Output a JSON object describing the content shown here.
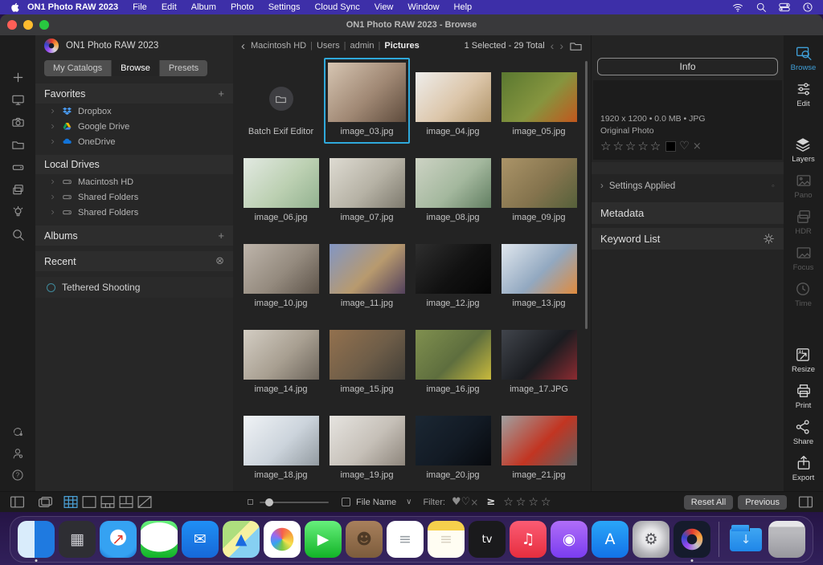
{
  "menu_bar": {
    "app_name": "ON1 Photo RAW 2023",
    "items": [
      "File",
      "Edit",
      "Album",
      "Photo",
      "Settings",
      "Cloud Sync",
      "View",
      "Window",
      "Help"
    ],
    "right_icons": [
      "wifi-icon",
      "search-icon",
      "control-center-icon",
      "clock-icon"
    ]
  },
  "window": {
    "title": "ON1 Photo RAW 2023 - Browse"
  },
  "left_rail": {
    "top": [
      "plus-icon",
      "monitor-icon",
      "camera-icon",
      "folder-icon",
      "drive-icon",
      "copies-icon",
      "bulb-icon",
      "search-icon"
    ],
    "bottom": [
      "sync-icon",
      "user-icon",
      "help-icon"
    ]
  },
  "sidebar": {
    "app_title": "ON1 Photo RAW 2023",
    "tabs": [
      {
        "label": "My Catalogs",
        "active": false
      },
      {
        "label": "Browse",
        "active": true
      },
      {
        "label": "Presets",
        "active": false
      }
    ],
    "sections": {
      "favorites": {
        "label": "Favorites",
        "action_icon": "plus-icon",
        "items": [
          {
            "label": "Dropbox",
            "icon": "dropbox-icon"
          },
          {
            "label": "Google Drive",
            "icon": "gdrive-icon"
          },
          {
            "label": "OneDrive",
            "icon": "onedrive-icon"
          }
        ]
      },
      "local_drives": {
        "label": "Local Drives",
        "items": [
          {
            "label": "Macintosh HD",
            "icon": "drive-icon"
          },
          {
            "label": "Shared Folders",
            "icon": "drive-icon"
          },
          {
            "label": "Shared Folders",
            "icon": "drive-icon"
          }
        ]
      },
      "albums": {
        "label": "Albums",
        "action_icon": "plus-icon"
      },
      "recent": {
        "label": "Recent",
        "action_icon": "clear-icon"
      },
      "tethered": {
        "label": "Tethered Shooting"
      }
    }
  },
  "browser_header": {
    "path": [
      "Macintosh HD",
      "Users",
      "admin",
      "Pictures"
    ],
    "status": "1 Selected - 29 Total"
  },
  "grid": {
    "selection_color": "#2fa9db",
    "items": [
      {
        "kind": "folder",
        "label": "Batch Exif Editor"
      },
      {
        "kind": "image",
        "label": "image_03.jpg",
        "selected": true,
        "colors": [
          "#d6c5b2",
          "#a08874",
          "#5f4c3d"
        ]
      },
      {
        "kind": "image",
        "label": "image_04.jpg",
        "colors": [
          "#eeedeb",
          "#dcc6aa",
          "#b09468"
        ]
      },
      {
        "kind": "image",
        "label": "image_05.jpg",
        "colors": [
          "#5a7830",
          "#86953f",
          "#c2571d"
        ]
      },
      {
        "kind": "image",
        "label": "image_06.jpg",
        "colors": [
          "#e2e9e2",
          "#bcd0b2",
          "#93b290"
        ]
      },
      {
        "kind": "image",
        "label": "image_07.jpg",
        "colors": [
          "#dedbd2",
          "#b6b2a5",
          "#7e7a6e"
        ]
      },
      {
        "kind": "image",
        "label": "image_08.jpg",
        "colors": [
          "#cdd3c4",
          "#a4b89e",
          "#627f62"
        ]
      },
      {
        "kind": "image",
        "label": "image_09.jpg",
        "colors": [
          "#ab9468",
          "#85744e",
          "#55603a"
        ]
      },
      {
        "kind": "image",
        "label": "image_10.jpg",
        "colors": [
          "#beb5ab",
          "#948a7e",
          "#5e544a"
        ]
      },
      {
        "kind": "image",
        "label": "image_11.jpg",
        "colors": [
          "#8296c4",
          "#b89a6e",
          "#52405c"
        ]
      },
      {
        "kind": "image",
        "label": "image_12.jpg",
        "colors": [
          "#2e2e2e",
          "#111111",
          "#050505"
        ]
      },
      {
        "kind": "image",
        "label": "image_13.jpg",
        "colors": [
          "#e0e7ee",
          "#92a8c0",
          "#e08b3e"
        ]
      },
      {
        "kind": "image",
        "label": "image_14.jpg",
        "colors": [
          "#d3cdc3",
          "#a89f91",
          "#6e665c"
        ]
      },
      {
        "kind": "image",
        "label": "image_15.jpg",
        "colors": [
          "#93714e",
          "#6e5d48",
          "#423e37"
        ]
      },
      {
        "kind": "image",
        "label": "image_16.jpg",
        "colors": [
          "#80904f",
          "#5e6e3e",
          "#c9ba3d"
        ]
      },
      {
        "kind": "image",
        "label": "image_17.JPG",
        "colors": [
          "#41454c",
          "#1a1c20",
          "#8c2b31"
        ]
      },
      {
        "kind": "image",
        "label": "image_18.jpg",
        "colors": [
          "#f0f3f6",
          "#ccd4dc",
          "#939ba1"
        ]
      },
      {
        "kind": "image",
        "label": "image_19.jpg",
        "colors": [
          "#e6e4e0",
          "#c6c0b8",
          "#8e867c"
        ]
      },
      {
        "kind": "image",
        "label": "image_20.jpg",
        "colors": [
          "#1b2733",
          "#121a24",
          "#07090d"
        ]
      },
      {
        "kind": "image",
        "label": "image_21.jpg",
        "colors": [
          "#a0a0a0",
          "#c23522",
          "#606060"
        ]
      }
    ]
  },
  "info_panel": {
    "button_label": "Info",
    "details": "1920 x 1200  •  0.0 MB  •  JPG",
    "type_label": "Original Photo",
    "rating_stars": 5,
    "swatch_color": "#000000",
    "settings_applied_label": "Settings Applied",
    "metadata_label": "Metadata",
    "keyword_list_label": "Keyword List"
  },
  "right_rail": {
    "accent": "#3f9fd8",
    "top": [
      {
        "label": "Browse",
        "icon": "browse-icon",
        "state": "active"
      },
      {
        "label": "Edit",
        "icon": "edit-icon",
        "state": "normal"
      }
    ],
    "middle": [
      {
        "label": "Layers",
        "icon": "layers-icon",
        "state": "normal"
      },
      {
        "label": "Pano",
        "icon": "pano-icon",
        "state": "disabled"
      },
      {
        "label": "HDR",
        "icon": "hdr-icon",
        "state": "disabled"
      },
      {
        "label": "Focus",
        "icon": "focus-icon",
        "state": "disabled"
      },
      {
        "label": "Time",
        "icon": "time-icon",
        "state": "disabled"
      }
    ],
    "bottom": [
      {
        "label": "Resize",
        "icon": "resize-icon",
        "state": "normal"
      },
      {
        "label": "Print",
        "icon": "print-icon",
        "state": "normal"
      },
      {
        "label": "Share",
        "icon": "share-icon",
        "state": "normal"
      },
      {
        "label": "Export",
        "icon": "export-icon",
        "state": "normal"
      }
    ]
  },
  "bottom_bar": {
    "view_icons": [
      "grid-view-icon",
      "single-view-icon",
      "split-view-icon",
      "dual-view-icon",
      "compare-view-icon"
    ],
    "active_view": 0,
    "filename_toggle": {
      "label": "File Name",
      "checked": false
    },
    "filter": {
      "label": "Filter:",
      "ge_symbol": "≥",
      "stars": 4
    },
    "buttons": [
      {
        "label": "Reset All"
      },
      {
        "label": "Previous"
      }
    ]
  },
  "dock": {
    "items": [
      {
        "name": "finder",
        "bg": "linear-gradient(90deg,#d9ecfb 0 46%,#1f7ae0 46% 100%)",
        "glyph": "",
        "running": true
      },
      {
        "name": "launchpad",
        "bg": "#2e2e33",
        "glyph": "▦",
        "fg": "#cfcfd4"
      },
      {
        "name": "safari",
        "bg": "radial-gradient(circle at 50% 45%, #ffffff 0 28%, #35a2f2 30% 70%, #1668c8 100%)",
        "glyph": "↗",
        "fg": "#e23b2e"
      },
      {
        "name": "messages",
        "bg": "radial-gradient(ellipse 56% 40% at 50% 44%, #ffffff 98%, transparent 100%), linear-gradient(180deg,#67f07c,#12b327)",
        "glyph": ""
      },
      {
        "name": "mail",
        "bg": "linear-gradient(180deg,#1f8ff5,#1668d8)",
        "glyph": "✉",
        "fg": "#ffffff"
      },
      {
        "name": "maps",
        "bg": "linear-gradient(135deg,#aede7e 0 38%,#f6f1a0 38% 58%,#86d0f2 58% 100%)",
        "glyph": "▲",
        "fg": "#1a6ae0"
      },
      {
        "name": "photos",
        "bg": "radial-gradient(circle at 50% 50%, transparent 0 14px, #ffffff 14.5px), conic-gradient(#f65e4e,#f6a23c,#f6e14e,#7ac943,#35a2f2,#9a6af0,#f65e4e)",
        "glyph": ""
      },
      {
        "name": "facetime",
        "bg": "linear-gradient(180deg,#67f07c,#12b327)",
        "glyph": "▶",
        "fg": "#ffffff"
      },
      {
        "name": "contacts",
        "bg": "linear-gradient(180deg,#a8805c,#7c5c3c)",
        "glyph": "☻",
        "fg": "#4e3a26"
      },
      {
        "name": "reminders",
        "bg": "#ffffff",
        "glyph": "≡",
        "fg": "#9aa0a6"
      },
      {
        "name": "notes",
        "bg": "linear-gradient(180deg,#f6d04c 0 26%,#fffdf2 26%)",
        "glyph": "≡",
        "fg": "#d8d2c2"
      },
      {
        "name": "tv",
        "bg": "#1a1a1c",
        "glyph": "tv",
        "fg": "#ffffff"
      },
      {
        "name": "music",
        "bg": "linear-gradient(180deg,#fb5c74,#e62e3e)",
        "glyph": "♫",
        "fg": "#ffffff"
      },
      {
        "name": "podcasts",
        "bg": "linear-gradient(180deg,#b06ef8,#7a3cf0)",
        "glyph": "◉",
        "fg": "#ffffff"
      },
      {
        "name": "app-store",
        "bg": "linear-gradient(180deg,#2aa6f8,#1272e8)",
        "glyph": "A",
        "fg": "#ffffff"
      },
      {
        "name": "system-settings",
        "bg": "radial-gradient(circle at 50% 45%, #e8e8ea 0 30%, #b8b8bc 60%, #8a8a90 100%)",
        "glyph": "⚙",
        "fg": "#55555a"
      },
      {
        "name": "on1-photo-raw",
        "bg": "radial-gradient(circle at 50% 50%, #151b2c 0 6px, transparent 6.5px 13px, #151b2c 13.5px), conic-gradient(#e23b2e,#f6a23c,#c0c0c8,#9a4af0,#3546c8,#e23b2e)",
        "glyph": "",
        "running": true
      },
      {
        "name": "separator",
        "kind": "separator"
      },
      {
        "name": "downloads",
        "kind": "folder",
        "bg": "linear-gradient(180deg,#3fa6f2,#1f86e8)",
        "glyph": "↓",
        "fg": "#d6ecfc"
      },
      {
        "name": "trash",
        "bg": "linear-gradient(180deg,#e6e6e8 0 16%, #b9b9bd 16% 32%, #97979d)",
        "glyph": ""
      }
    ]
  }
}
